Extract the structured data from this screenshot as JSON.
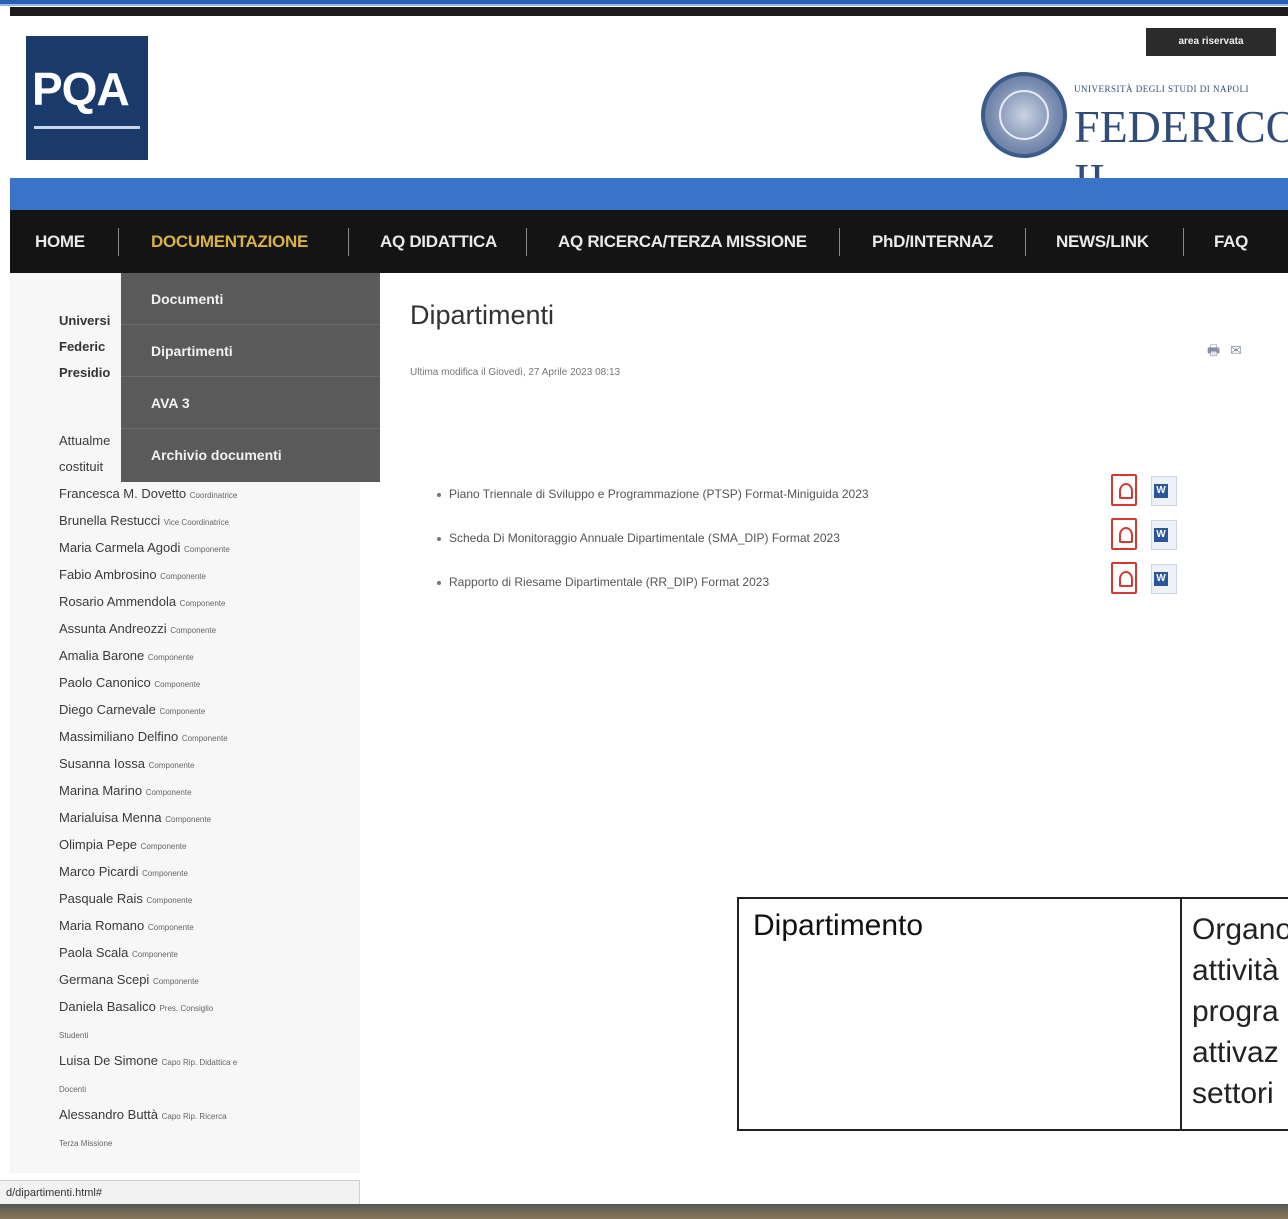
{
  "header": {
    "logo_text": "PQA",
    "area_button": "area riservata",
    "university_small": "UNIVERSITÀ DEGLI STUDI DI NAPOLI",
    "university_big": "FEDERICO II"
  },
  "nav": {
    "items": [
      {
        "label": "HOME"
      },
      {
        "label": "DOCUMENTAZIONE"
      },
      {
        "label": "AQ DIDATTICA"
      },
      {
        "label": "AQ RICERCA/TERZA MISSIONE"
      },
      {
        "label": "PhD/INTERNAZ"
      },
      {
        "label": "NEWS/LINK"
      },
      {
        "label": "FAQ"
      }
    ],
    "active": "DOCUMENTAZIONE"
  },
  "dropdown": {
    "items": [
      {
        "label": "Documenti"
      },
      {
        "label": "Dipartimenti"
      },
      {
        "label": "AVA 3"
      },
      {
        "label": "Archivio documenti"
      }
    ]
  },
  "sidebar": {
    "intro": [
      "Universi",
      "Federic",
      "Presidio"
    ],
    "members_intro": [
      "Attualme",
      "costituit"
    ],
    "members": [
      {
        "name": "Francesca M. Dovetto",
        "role": "Coordinatrice"
      },
      {
        "name": "Brunella Restucci",
        "role": "Vice Coordinatrice"
      },
      {
        "name": "Maria Carmela Agodi",
        "role": "Componente"
      },
      {
        "name": "Fabio Ambrosino",
        "role": "Componente"
      },
      {
        "name": "Rosario Ammendola",
        "role": "Componente"
      },
      {
        "name": "Assunta Andreozzi",
        "role": "Componente"
      },
      {
        "name": "Amalia Barone",
        "role": "Componente"
      },
      {
        "name": "Paolo Canonico",
        "role": "Componente"
      },
      {
        "name": "Diego Carnevale",
        "role": "Componente"
      },
      {
        "name": "Massimiliano Delfino",
        "role": "Componente"
      },
      {
        "name": "Susanna Iossa",
        "role": "Componente"
      },
      {
        "name": "Marina Marino",
        "role": "Componente"
      },
      {
        "name": "Marialuisa Menna",
        "role": "Componente"
      },
      {
        "name": "Olimpia Pepe",
        "role": "Componente"
      },
      {
        "name": "Marco Picardi",
        "role": "Componente"
      },
      {
        "name": "Pasquale Rais",
        "role": "Componente"
      },
      {
        "name": "Maria Romano",
        "role": "Componente"
      },
      {
        "name": "Paola Scala",
        "role": "Componente"
      },
      {
        "name": "Germana Scepi",
        "role": "Componente"
      },
      {
        "name": "Daniela Basalico",
        "role": "Pres. Consiglio"
      },
      {
        "name": "",
        "role": "Studenti"
      },
      {
        "name": "Luisa De Simone",
        "role": "Capo Rip. Didattica e"
      },
      {
        "name": "",
        "role": "Docenti"
      },
      {
        "name": "Alessandro Buttà",
        "role": "Capo Rip. Ricerca"
      },
      {
        "name": "",
        "role": "Terza Missione"
      }
    ]
  },
  "content": {
    "title": "Dipartimenti",
    "modified": "Ultima modifica il Giovedì, 27 Aprile 2023 08:13",
    "tools": {
      "print": "🖶",
      "email": "✉"
    },
    "documents": [
      {
        "label": "Piano Triennale di Sviluppo e Programmazione (PTSP) Format-Miniguida 2023"
      },
      {
        "label": "Scheda Di Monitoraggio Annuale Dipartimentale (SMA_DIP) Format 2023"
      },
      {
        "label": "Rapporto di Riesame Dipartimentale (RR_DIP) Format 2023"
      }
    ]
  },
  "table": {
    "col1": "Dipartimento",
    "col2_lines": [
      "Organo",
      "attività",
      "progra",
      "attivaz",
      "settori"
    ]
  },
  "status": {
    "url": "d/dipartimenti.html#"
  }
}
